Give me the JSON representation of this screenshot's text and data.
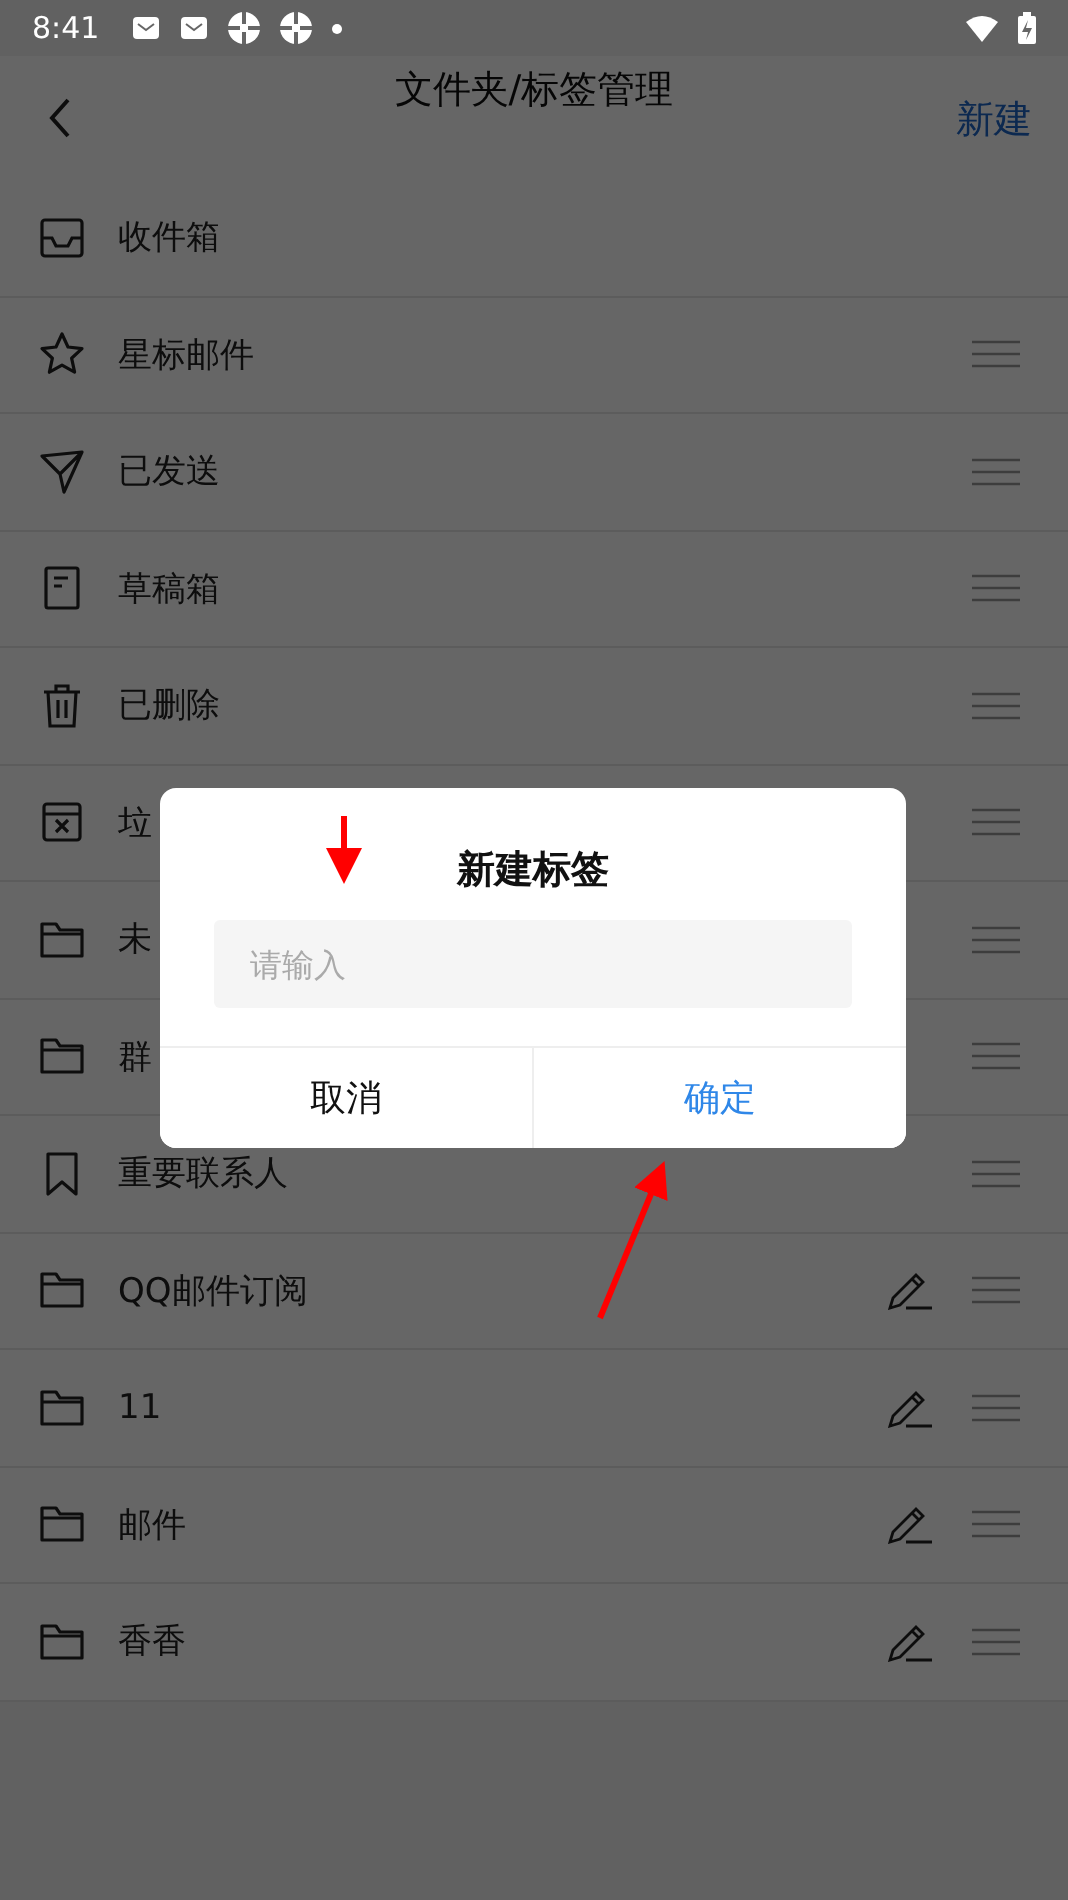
{
  "status_bar": {
    "time": "8:41"
  },
  "header": {
    "title": "文件夹/标签管理",
    "action": "新建"
  },
  "items": [
    {
      "label": "收件箱",
      "kind": "inbox",
      "draggable": false,
      "editable": false
    },
    {
      "label": "星标邮件",
      "kind": "star",
      "draggable": true,
      "editable": false
    },
    {
      "label": "已发送",
      "kind": "sent",
      "draggable": true,
      "editable": false
    },
    {
      "label": "草稿箱",
      "kind": "draft",
      "draggable": true,
      "editable": false
    },
    {
      "label": "已删除",
      "kind": "trash",
      "draggable": true,
      "editable": false
    },
    {
      "label": "垃",
      "kind": "spam",
      "draggable": true,
      "editable": false
    },
    {
      "label": "未",
      "kind": "folder",
      "draggable": true,
      "editable": false
    },
    {
      "label": "群",
      "kind": "folder",
      "draggable": true,
      "editable": false
    },
    {
      "label": "重要联系人",
      "kind": "bookmark",
      "draggable": true,
      "editable": false
    },
    {
      "label": "QQ邮件订阅",
      "kind": "folder",
      "draggable": true,
      "editable": true
    },
    {
      "label": "11",
      "kind": "folder",
      "draggable": true,
      "editable": true
    },
    {
      "label": "邮件",
      "kind": "folder",
      "draggable": true,
      "editable": true
    },
    {
      "label": "香香",
      "kind": "folder",
      "draggable": true,
      "editable": true
    }
  ],
  "dialog": {
    "title": "新建标签",
    "placeholder": "请输入",
    "buttons": [
      {
        "label": "取消",
        "kind": "cancel"
      },
      {
        "label": "确定",
        "kind": "confirm"
      }
    ]
  }
}
